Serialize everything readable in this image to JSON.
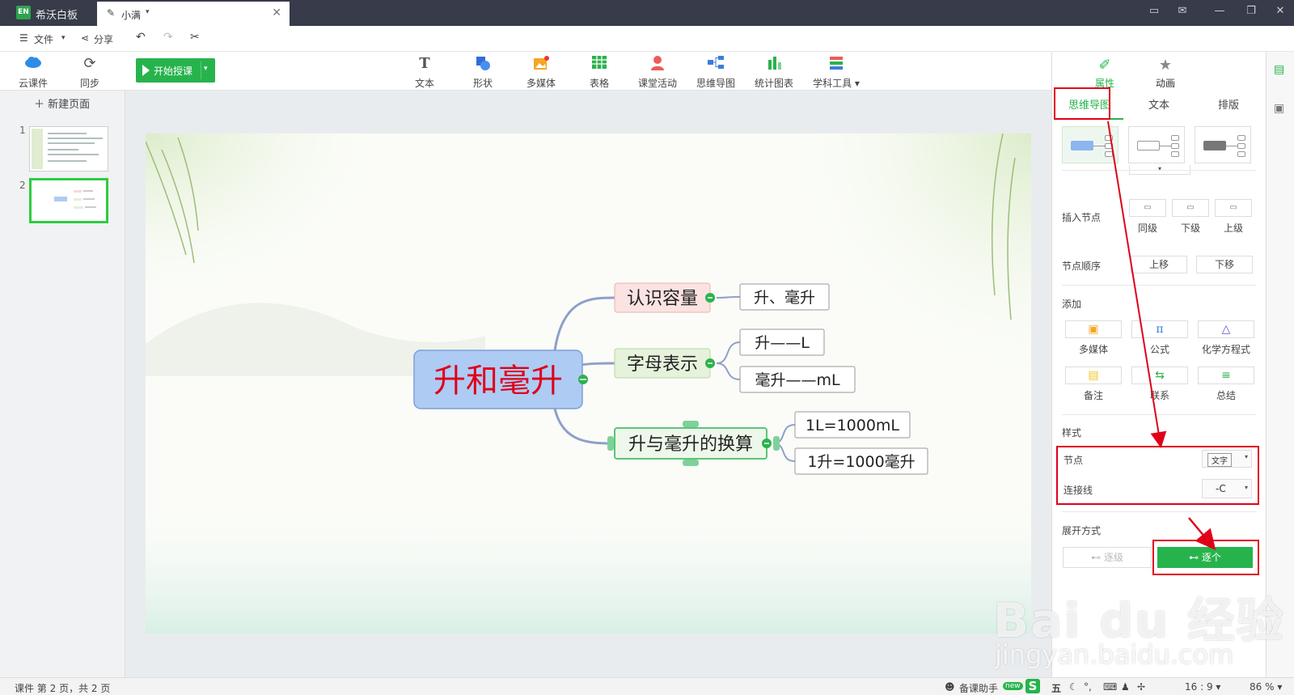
{
  "app": {
    "name": "希沃白板",
    "logo_text": "EN"
  },
  "doc_tab": {
    "title": "小满"
  },
  "window_icons": [
    "chat-icon",
    "mail-icon",
    "minimize-icon",
    "restore-icon",
    "close-icon"
  ],
  "menubar": {
    "file": "文件",
    "share": "分享"
  },
  "toolbar": {
    "cloud": "云课件",
    "sync": "同步",
    "start": "开始授课",
    "items": [
      {
        "label": "文本",
        "icon": "text-icon"
      },
      {
        "label": "形状",
        "icon": "shape-icon"
      },
      {
        "label": "多媒体",
        "icon": "media-icon"
      },
      {
        "label": "表格",
        "icon": "table-icon"
      },
      {
        "label": "课堂活动",
        "icon": "activity-icon"
      },
      {
        "label": "思维导图",
        "icon": "mindmap-icon"
      },
      {
        "label": "统计图表",
        "icon": "chart-icon"
      },
      {
        "label": "学科工具",
        "icon": "subject-tool-icon"
      }
    ]
  },
  "sidebar": {
    "new_page": "新建页面",
    "pages": [
      "1",
      "2"
    ],
    "selected": 2
  },
  "mindmap": {
    "root": "升和毫升",
    "branches": [
      {
        "label": "认识容量",
        "children": [
          "升、毫升"
        ]
      },
      {
        "label": "字母表示",
        "children": [
          "升——L",
          "毫升——mL"
        ]
      },
      {
        "label": "升与毫升的换算",
        "children": [
          "1L=1000mL",
          "1升=1000毫升"
        ]
      }
    ]
  },
  "right_panel": {
    "tabs": [
      "属性",
      "动画"
    ],
    "sub_tabs": [
      "思维导图",
      "文本",
      "排版"
    ],
    "insert_node": {
      "label": "插入节点",
      "buttons": [
        "同级",
        "下级",
        "上级"
      ]
    },
    "node_order": {
      "label": "节点顺序",
      "buttons": [
        "上移",
        "下移"
      ]
    },
    "add": {
      "label": "添加",
      "items": [
        "多媒体",
        "公式",
        "化学方程式",
        "备注",
        "联系",
        "总结"
      ]
    },
    "style": {
      "label": "样式",
      "node_label": "节点",
      "node_value": "文字",
      "line_label": "连接线",
      "line_value": "-C"
    },
    "expand": {
      "label": "展开方式",
      "option1": "逐级",
      "option2": "逐个"
    }
  },
  "statusbar": {
    "page_info": "课件 第 2 页，共 2 页",
    "assistant": "备课助手",
    "new_badge": "new",
    "ime": "五",
    "ratio": "16 : 9",
    "zoom": "86 %"
  },
  "watermark": {
    "text": "Bai du 经验",
    "url": "jingyan.baidu.com"
  },
  "colors": {
    "accent": "#27b34c",
    "root_fill": "#aecbf4",
    "root_text": "#e0001a",
    "annotation_red": "#e0001a",
    "titlebar": "#373b4a"
  }
}
